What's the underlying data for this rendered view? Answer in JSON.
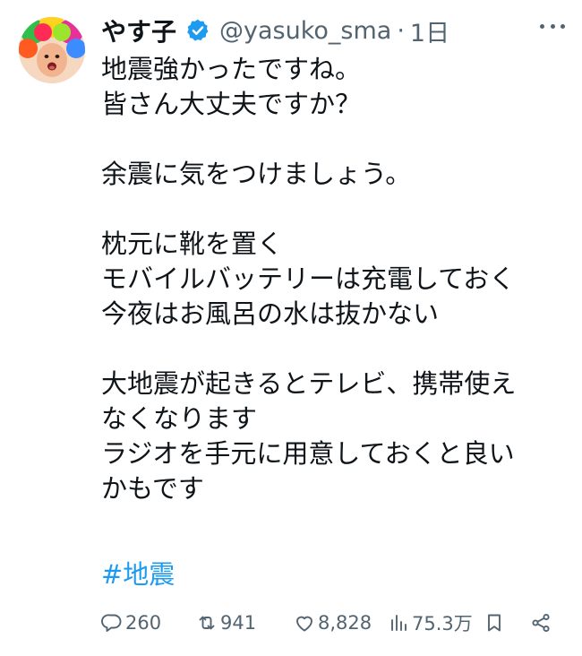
{
  "author": {
    "name": "やす子",
    "handle": "@yasuko_sma",
    "separator": "·",
    "time": "1日",
    "verified_icon": "verified-badge-icon",
    "verified_color": "#1d9bf0"
  },
  "tweet": {
    "text": "地震強かったですね。\n皆さん大丈夫ですか？\n\n余震に気をつけましょう。\n\n枕元に靴を置く\nモバイルバッテリーは充電しておく\n今夜はお風呂の水は抜かない\n\n大地震が起きるとテレビ、携帯使え\nなくなります\nラジオを手元に用意しておくと良い\nかもです",
    "hashtag": "#地震",
    "hashtag_color": "#1d9bf0"
  },
  "actions": {
    "reply": {
      "count": "260",
      "icon": "reply-icon"
    },
    "retweet": {
      "count": "941",
      "icon": "retweet-icon"
    },
    "like": {
      "count": "8,828",
      "icon": "heart-icon"
    },
    "views": {
      "count": "75.3万",
      "icon": "analytics-icon"
    },
    "bookmark": {
      "icon": "bookmark-icon"
    },
    "share": {
      "icon": "share-icon"
    }
  },
  "colors": {
    "text": "#0f1419",
    "secondary": "#536471",
    "accent": "#1d9bf0"
  }
}
